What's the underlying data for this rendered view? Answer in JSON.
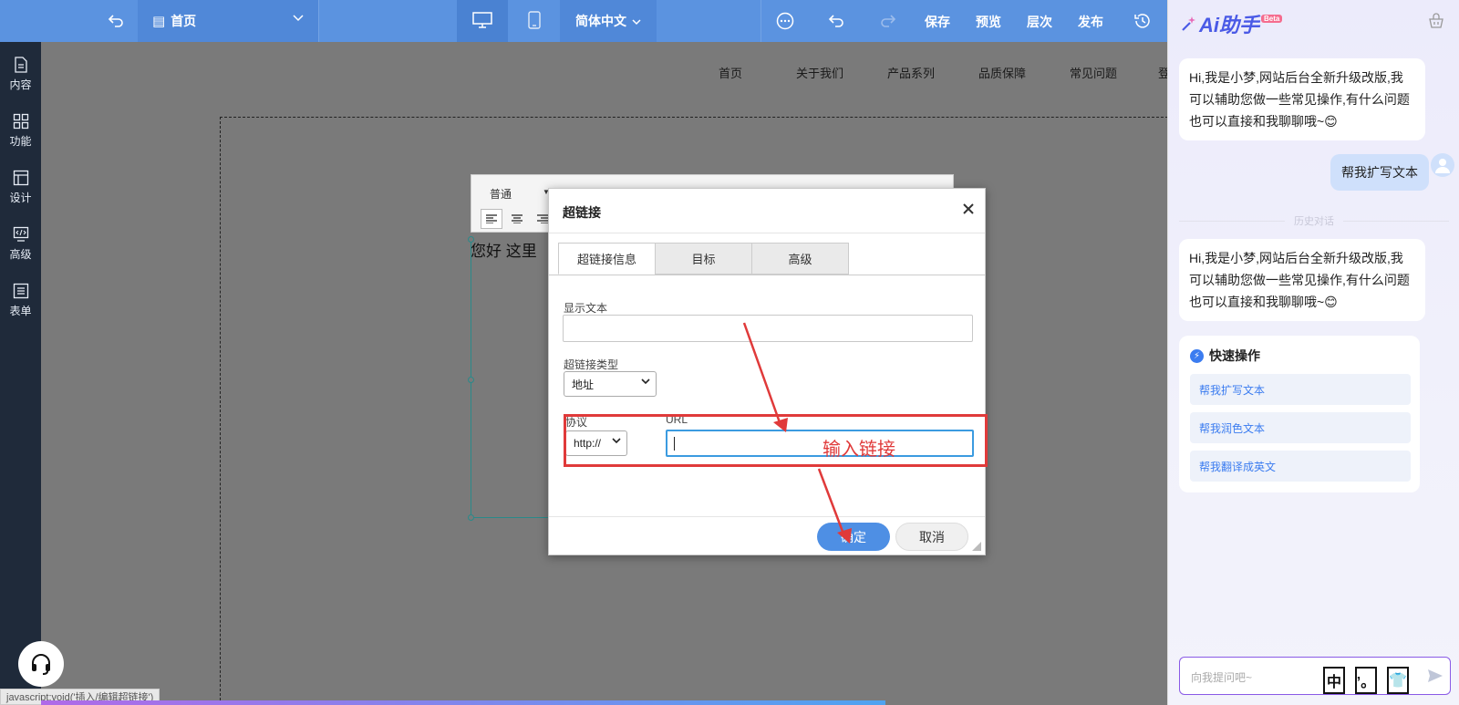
{
  "toolbar": {
    "page_name": "首页",
    "language": "简体中文",
    "save": "保存",
    "preview": "预览",
    "layers": "层次",
    "publish": "发布"
  },
  "sidebar": {
    "items": [
      {
        "label": "内容",
        "icon": "file-icon"
      },
      {
        "label": "功能",
        "icon": "grid-icon"
      },
      {
        "label": "设计",
        "icon": "layout-icon"
      },
      {
        "label": "高级",
        "icon": "code-icon"
      },
      {
        "label": "表单",
        "icon": "list-icon"
      }
    ]
  },
  "site_nav": {
    "items": [
      "首页",
      "关于我们",
      "产品系列",
      "品质保障",
      "常见问题",
      "登"
    ]
  },
  "editor": {
    "format": "普通",
    "content_text": "您好  这里"
  },
  "dialog": {
    "title": "超链接",
    "tabs": [
      "超链接信息",
      "目标",
      "高级"
    ],
    "display_text_label": "显示文本",
    "display_text_value": "",
    "link_type_label": "超链接类型",
    "link_type_value": "地址",
    "protocol_label": "协议",
    "protocol_value": "http://",
    "url_label": "URL",
    "url_value": "",
    "ok": "确定",
    "cancel": "取消",
    "annotation": "输入链接"
  },
  "status_bar": {
    "text": "javascript:void('插入/编辑超链接')"
  },
  "ai_panel": {
    "title": "Ai助手",
    "badge": "Beta",
    "greeting": "Hi,我是小梦,网站后台全新升级改版,我可以辅助您做一些常见操作,有什么问题也可以直接和我聊聊哦~😊",
    "user_message": "帮我扩写文本",
    "history_divider": "历史对话",
    "greeting_2": "Hi,我是小梦,网站后台全新升级改版,我可以辅助您做一些常见操作,有什么问题也可以直接和我聊聊哦~😊",
    "quick_title": "快速操作",
    "quick_items": [
      "帮我扩写文本",
      "帮我润色文本",
      "帮我翻译成英文"
    ],
    "input_placeholder": "向我提问吧~",
    "ime_keys": [
      "中",
      "’。",
      "👕"
    ]
  },
  "colors": {
    "topbar": "#5b93e0",
    "sidebar": "#1f2a3a",
    "accent": "#4e8fe4",
    "annotation_red": "#e03a3a"
  },
  "progress": 0.75
}
